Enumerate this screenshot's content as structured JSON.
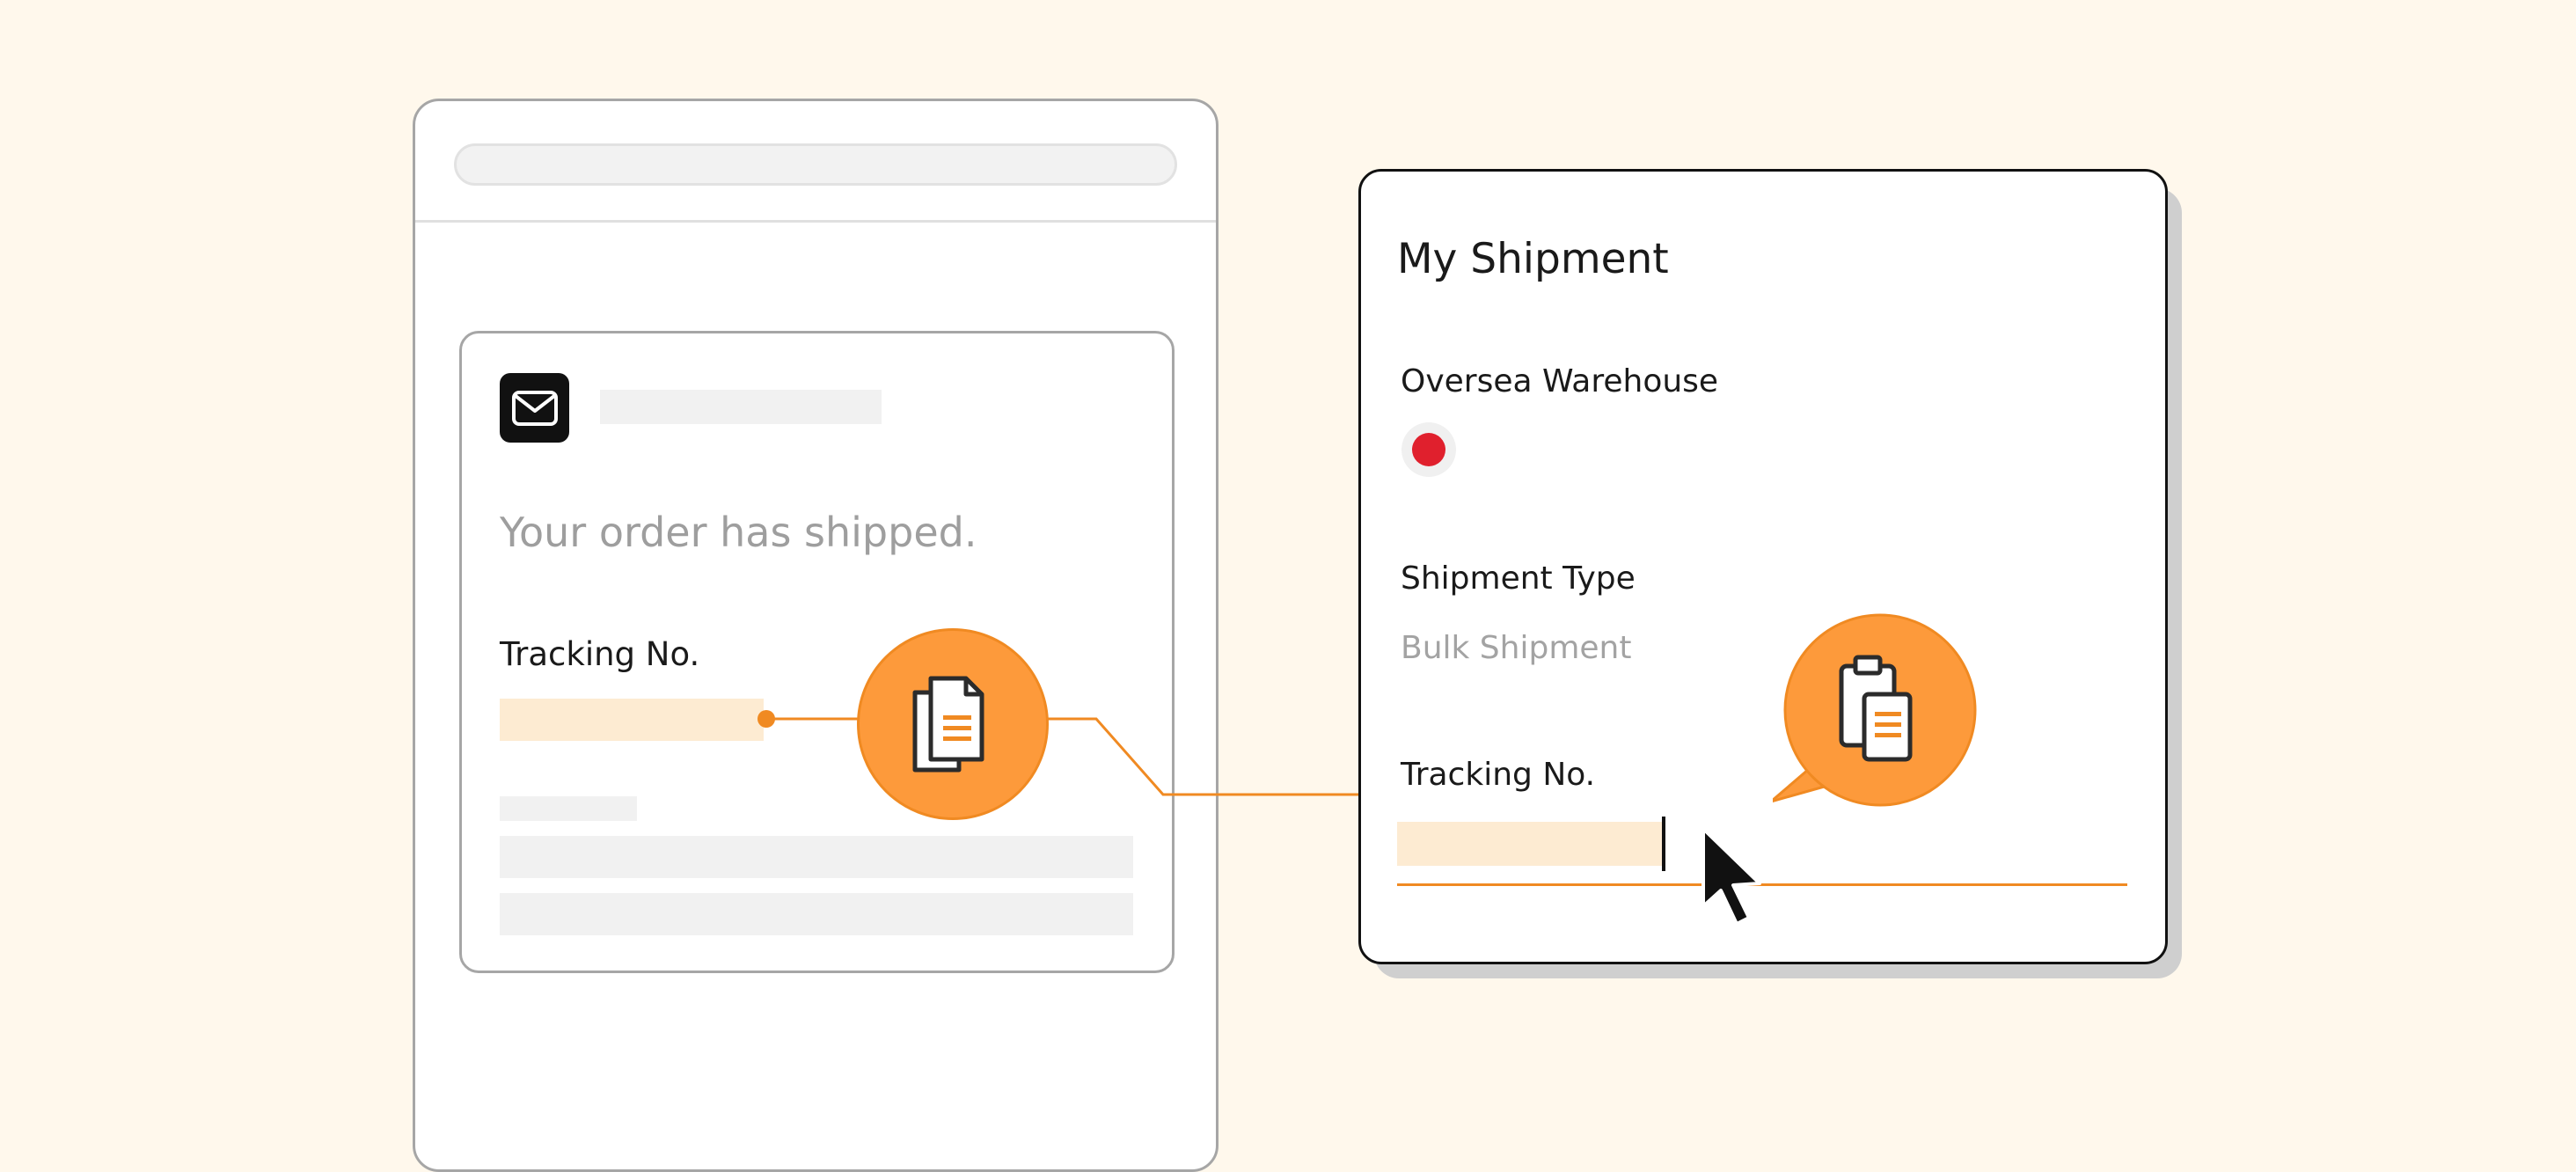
{
  "email": {
    "subject": "Your order has shipped.",
    "tracking_label": "Tracking No.",
    "mail_icon": "envelope-icon"
  },
  "shipment": {
    "title": "My Shipment",
    "warehouse_label": "Oversea Warehouse",
    "warehouse_flag": "red-dot-flag-icon",
    "type_label": "Shipment Type",
    "type_value": "Bulk Shipment",
    "tracking_label": "Tracking No.",
    "tracking_value": ""
  },
  "icons": {
    "copy": "copy-document-icon",
    "paste": "paste-clipboard-icon",
    "cursor": "mouse-pointer-icon"
  },
  "colors": {
    "background": "#fff8ec",
    "accent": "#fd9a3b",
    "accent_line": "#f08a22",
    "highlight": "#fdebd2",
    "flag_red": "#e0202d"
  }
}
